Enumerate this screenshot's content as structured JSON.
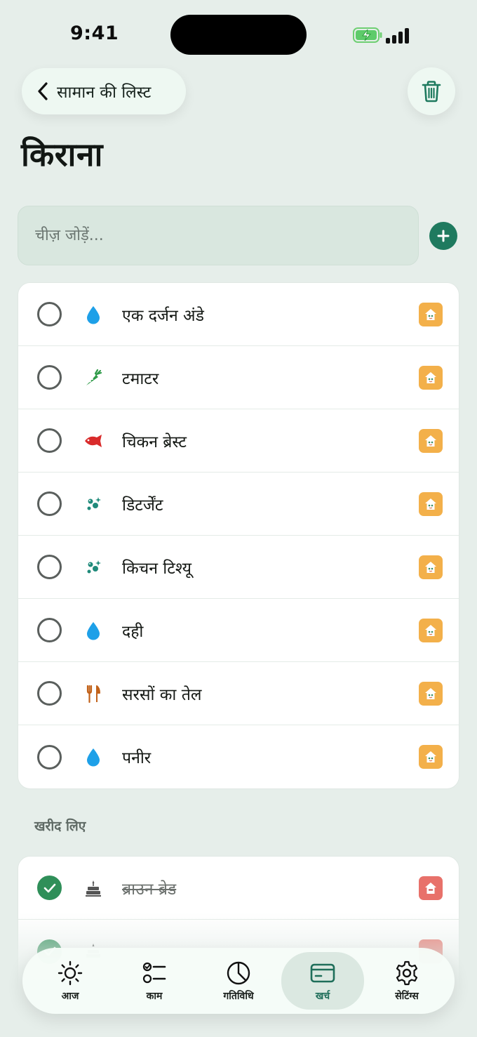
{
  "status_bar": {
    "time": "9:41"
  },
  "header": {
    "back_label": "सामान की लिस्ट",
    "title": "किराना"
  },
  "add_item": {
    "placeholder": "चीज़ जोड़ें..."
  },
  "items": [
    {
      "name": "एक दर्जन अंडे",
      "icon": "droplet-icon",
      "icon_color": "#1ea0e8"
    },
    {
      "name": "टमाटर",
      "icon": "carrot-icon",
      "icon_color": "#2e9a48"
    },
    {
      "name": "चिकन ब्रेस्ट",
      "icon": "fish-icon",
      "icon_color": "#d92b2b"
    },
    {
      "name": "डिटर्जेंट",
      "icon": "bubbles-icon",
      "icon_color": "#1f8a7a"
    },
    {
      "name": "किचन टिश्यू",
      "icon": "bubbles-icon",
      "icon_color": "#1f8a7a"
    },
    {
      "name": "दही",
      "icon": "droplet-icon",
      "icon_color": "#1ea0e8"
    },
    {
      "name": "सरसों का तेल",
      "icon": "fork-knife-icon",
      "icon_color": "#c2621a"
    },
    {
      "name": "पनीर",
      "icon": "droplet-icon",
      "icon_color": "#1ea0e8"
    }
  ],
  "purchased": {
    "label": "खरीद लिए",
    "items": [
      {
        "name": "ब्राउन ब्रेड",
        "icon": "cake-icon",
        "icon_color": "#555555"
      },
      {
        "name": "",
        "icon": "cake-icon",
        "icon_color": "#555555"
      }
    ]
  },
  "tabs": [
    {
      "label": "आज",
      "icon": "sun-icon",
      "active": false
    },
    {
      "label": "काम",
      "icon": "checklist-icon",
      "active": false
    },
    {
      "label": "गतिविधि",
      "icon": "pie-chart-icon",
      "active": false
    },
    {
      "label": "खर्च",
      "icon": "card-icon",
      "active": true
    },
    {
      "label": "सेटिंग्स",
      "icon": "gear-icon",
      "active": false
    }
  ],
  "colors": {
    "accent": "#1f7a5f",
    "background": "#e6eeea",
    "badge": "#f3b04a",
    "badge_alt": "#e8716a",
    "check": "#2f8f59"
  }
}
